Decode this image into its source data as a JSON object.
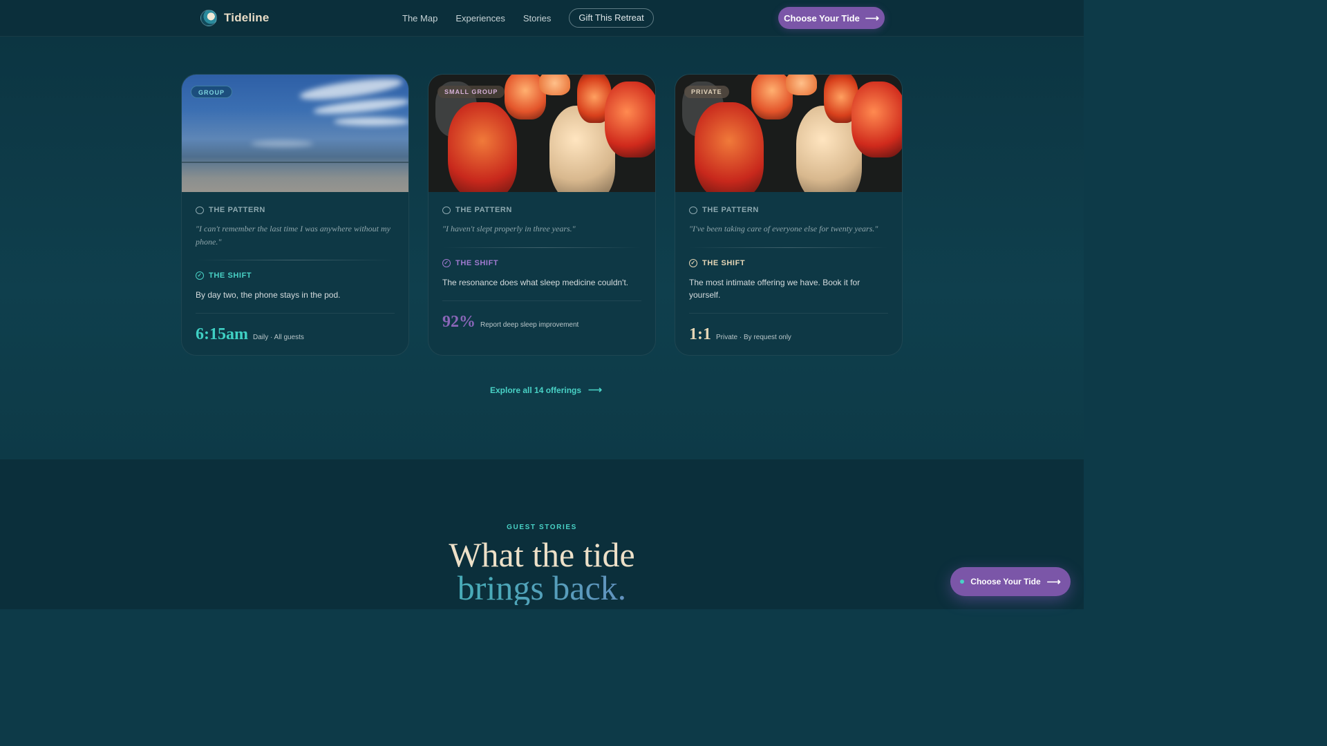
{
  "brand": {
    "name": "Tideline"
  },
  "nav": {
    "links": [
      "The Map",
      "Experiences",
      "Stories"
    ],
    "gift": "Gift This Retreat",
    "cta": "Choose Your Tide"
  },
  "cards": [
    {
      "badge": "GROUP",
      "pattern_label": "THE PATTERN",
      "quote": "\"I can't remember the last time I was anywhere without my phone.\"",
      "shift_label": "THE SHIFT",
      "shift_text": "By day two, the phone stays in the pod.",
      "stat_value": "6:15am",
      "stat_desc": "Daily · All guests",
      "stat_color": "#3fd0c4",
      "shift_color": "#49d2c6"
    },
    {
      "badge": "SMALL GROUP",
      "pattern_label": "THE PATTERN",
      "quote": "\"I haven't slept properly in three years.\"",
      "shift_label": "THE SHIFT",
      "shift_text": "The resonance does what sleep medicine couldn't.",
      "stat_value": "92%",
      "stat_desc": "Report deep sleep improvement",
      "stat_color": "#8a66b8",
      "shift_color": "#a07ad0"
    },
    {
      "badge": "PRIVATE",
      "pattern_label": "THE PATTERN",
      "quote": "\"I've been taking care of everyone else for twenty years.\"",
      "shift_label": "THE SHIFT",
      "shift_text": "The most intimate offering we have. Book it for yourself.",
      "stat_value": "1:1",
      "stat_desc": "Private · By request only",
      "stat_color": "#e6d6b6",
      "shift_color": "#e6d6b6"
    }
  ],
  "explore": "Explore all 14 offerings",
  "stories": {
    "eyebrow": "GUEST STORIES",
    "title_line1": "What the tide",
    "title_line2": "brings back."
  },
  "floating_cta": "Choose Your Tide"
}
